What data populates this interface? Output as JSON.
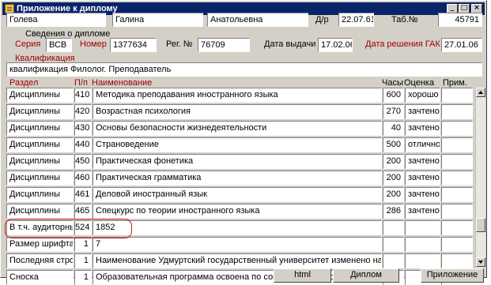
{
  "window": {
    "title": "Приложение к диплому"
  },
  "person": {
    "surname": "Голева",
    "name": "Галина",
    "patronymic": "Анатольевна",
    "dob_label": "Д/р",
    "dob": "22.07.61",
    "tab_label": "Таб.№",
    "tab": "45791"
  },
  "diploma": {
    "section_title": "Сведения о дипломе",
    "series_label": "Серия",
    "series": "ВСВ",
    "number_label": "Номер",
    "number": "1377634",
    "reg_label": "Рег. №",
    "reg": "76709",
    "issue_label": "Дата выдачи",
    "issue_date": "17.02.06",
    "gak_label": "Дата решения ГАК",
    "gak_date": "27.01.06"
  },
  "qualification": {
    "label": "Квалификация",
    "value": "квалификация Филолог. Преподаватель"
  },
  "table": {
    "headers": {
      "section": "Раздел",
      "pn": "П/п",
      "name": "Наименование",
      "hours": "Часы",
      "grade": "Оценка",
      "note": "Прим."
    },
    "rows": [
      {
        "section": "Дисциплины",
        "pn": "410",
        "name": "Методика преподавания иностранного языка",
        "hours": "600",
        "grade": "хорошо",
        "note": ""
      },
      {
        "section": "Дисциплины",
        "pn": "420",
        "name": "Возрастная психология",
        "hours": "270",
        "grade": "зачтено",
        "note": ""
      },
      {
        "section": "Дисциплины",
        "pn": "430",
        "name": "Основы безопасности жизнедеятельности",
        "hours": "40",
        "grade": "зачтено",
        "note": ""
      },
      {
        "section": "Дисциплины",
        "pn": "440",
        "name": "Страноведение",
        "hours": "500",
        "grade": "отлично",
        "note": ""
      },
      {
        "section": "Дисциплины",
        "pn": "450",
        "name": "Практическая фонетика",
        "hours": "200",
        "grade": "зачтено",
        "note": ""
      },
      {
        "section": "Дисциплины",
        "pn": "460",
        "name": "Практическая грамматика",
        "hours": "200",
        "grade": "зачтено",
        "note": ""
      },
      {
        "section": "Дисциплины",
        "pn": "461",
        "name": "Деловой иностранный язык",
        "hours": "200",
        "grade": "зачтено",
        "note": ""
      },
      {
        "section": "Дисциплины",
        "pn": "465",
        "name": "Спецкурс по теории иностранного языка",
        "hours": "286",
        "grade": "зачтено",
        "note": ""
      },
      {
        "section": "В т.ч. аудиторны",
        "pn": "524",
        "name": "1852",
        "hours": "",
        "grade": "",
        "note": ""
      },
      {
        "section": "Размер шрифта ,",
        "pn": "1",
        "name": "7",
        "hours": "",
        "grade": "",
        "note": ""
      },
      {
        "section": "Последняя строк",
        "pn": "1",
        "name": "Наименование Удмуртский государственный университет изменено на Госу",
        "hours": "",
        "grade": "",
        "note": ""
      },
      {
        "section": "Сноска",
        "pn": "1",
        "name": "Образовательная программа освоена по сокращенной программе",
        "hours": "",
        "grade": "",
        "note": ""
      }
    ]
  },
  "buttons": {
    "html": "html",
    "diploma": "Диплом",
    "appendix": "Приложение"
  },
  "colors": {
    "titlebar": "#0a246a",
    "label_red": "#a00000",
    "highlight": "#c81e1e"
  }
}
